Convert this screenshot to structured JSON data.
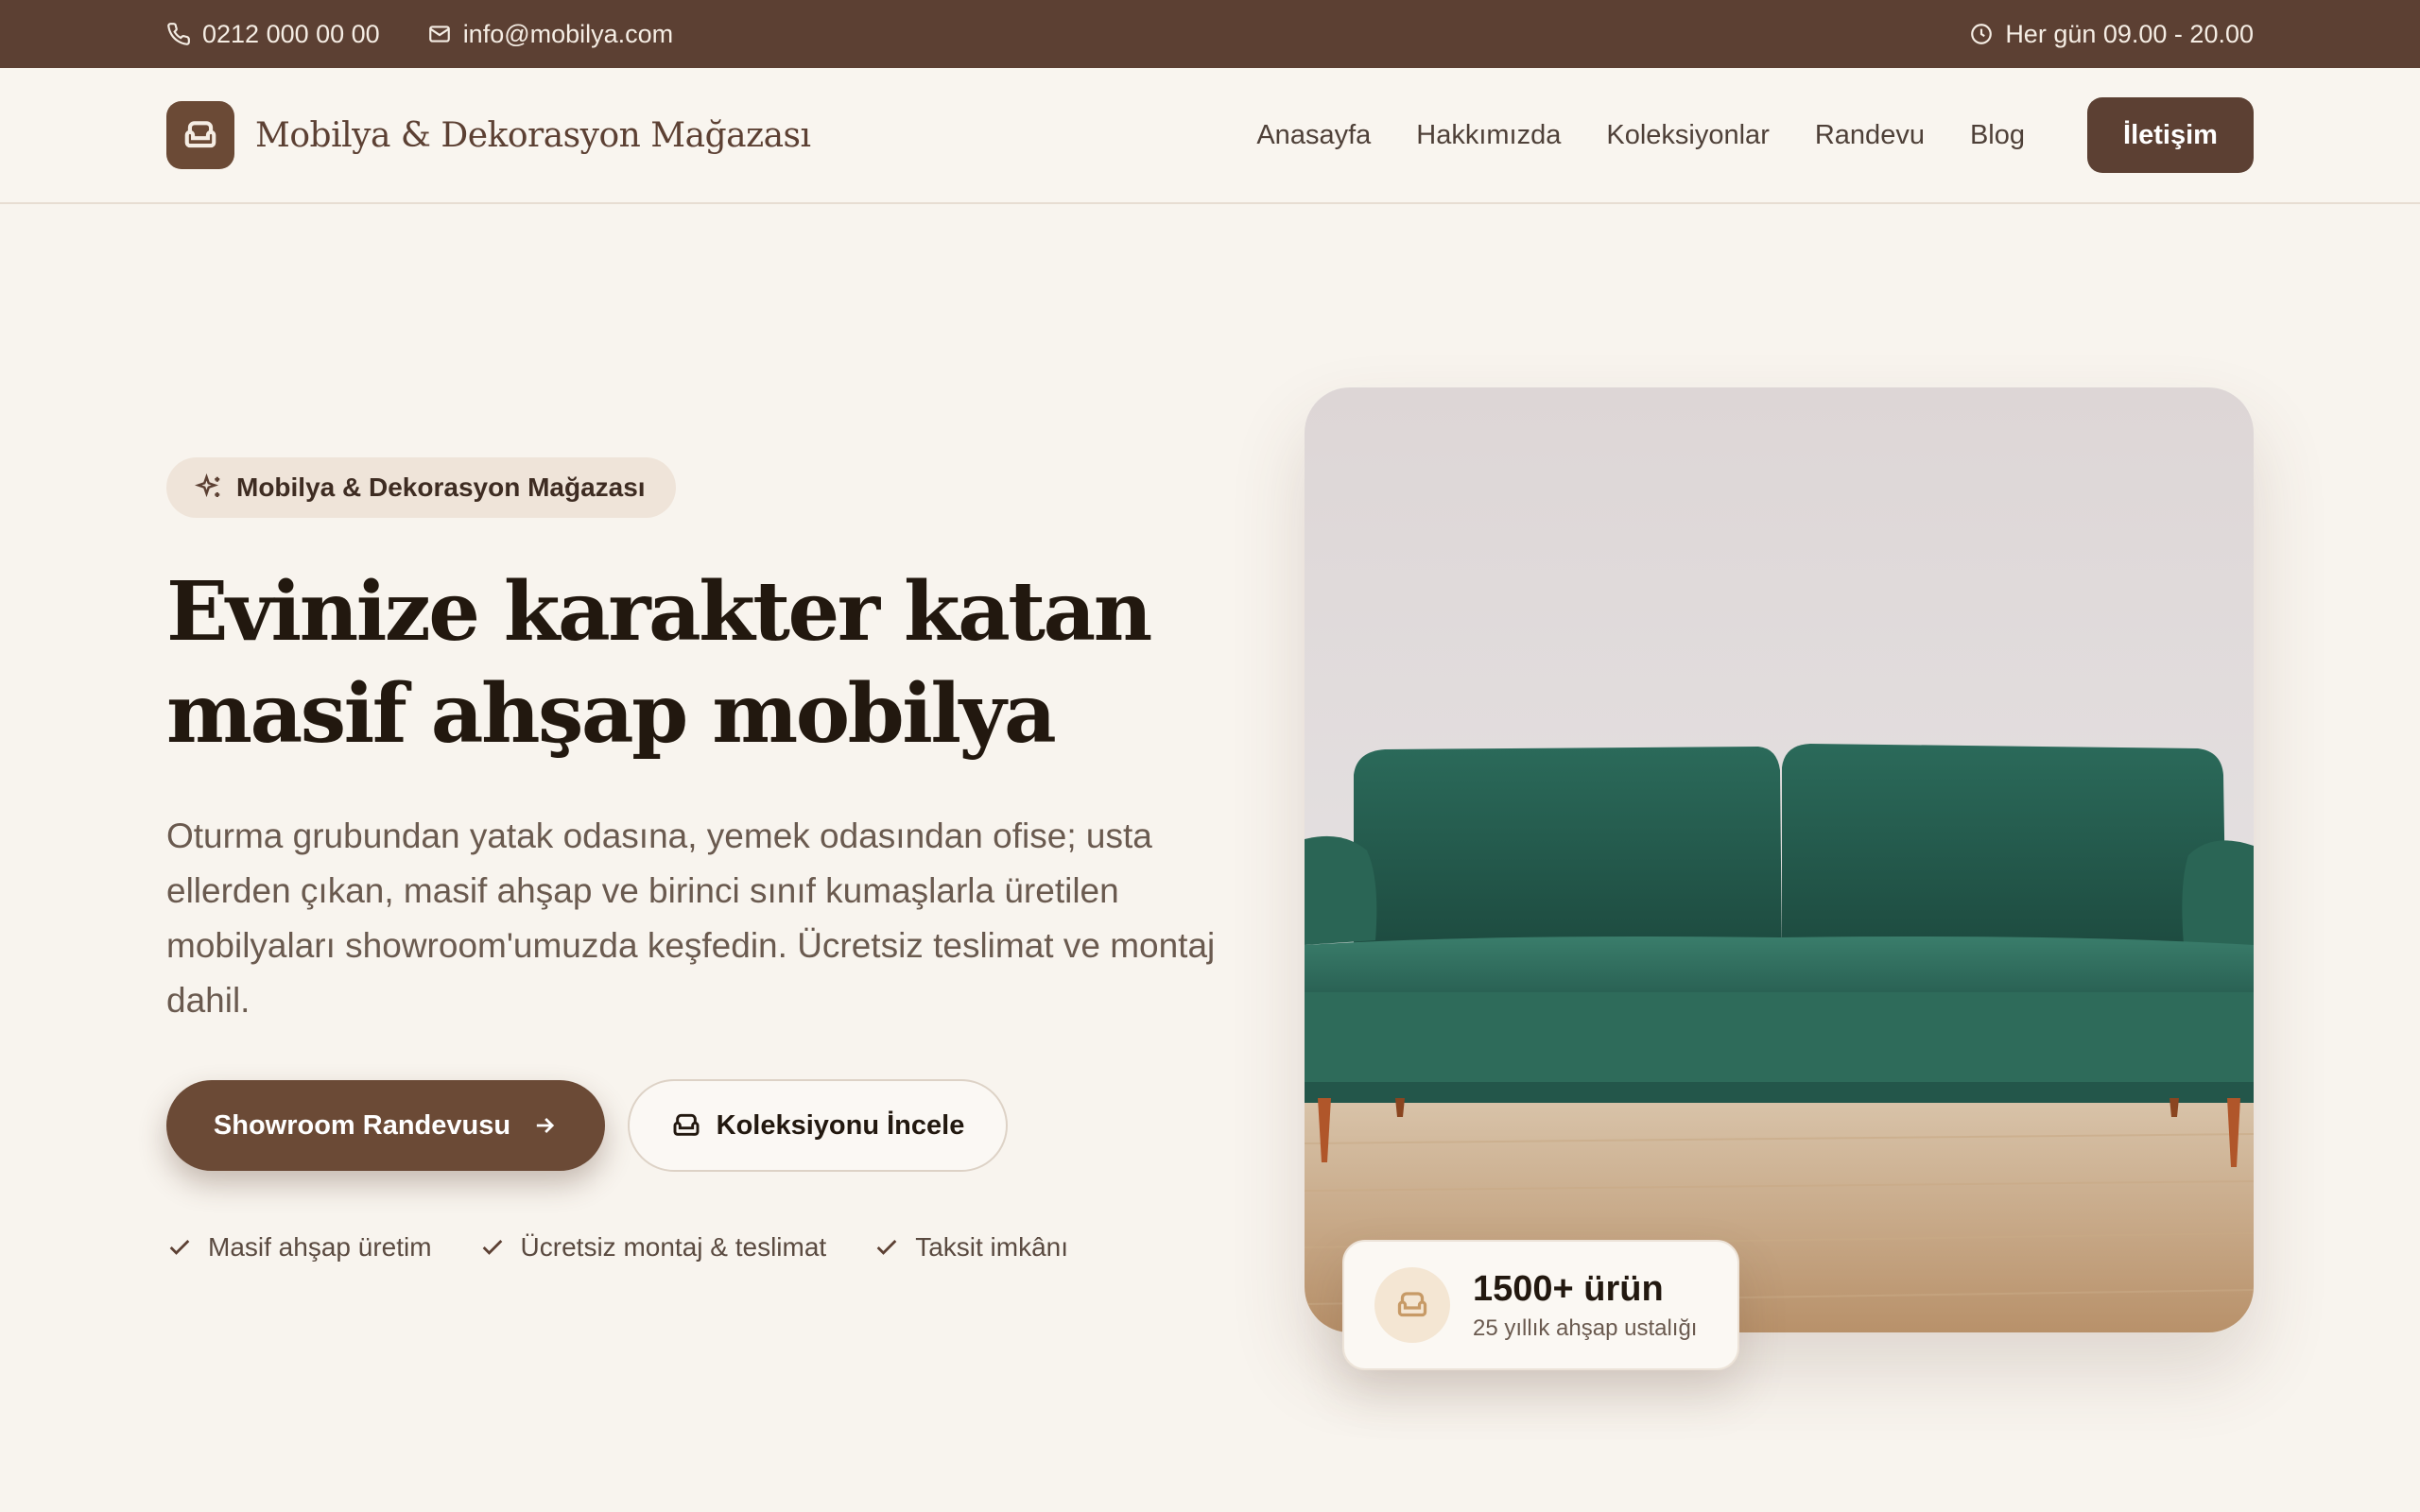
{
  "topbar": {
    "phone": "0212 000 00 00",
    "email": "info@mobilya.com",
    "hours": "Her gün 09.00 - 20.00"
  },
  "header": {
    "brand_name": "Mobilya & Dekorasyon Mağazası",
    "nav": [
      "Anasayfa",
      "Hakkımızda",
      "Koleksiyonlar",
      "Randevu",
      "Blog"
    ],
    "cta": "İletişim"
  },
  "hero": {
    "badge": "Mobilya & Dekorasyon Mağazası",
    "title": "Evinize karakter katan masif ahşap mobilya",
    "description": "Oturma grubundan yatak odasına, yemek odasından ofise; usta ellerden çıkan, masif ahşap ve birinci sınıf kumaşlarla üretilen mobilyaları showroom'umuzda keşfedin. Ücretsiz teslimat ve montaj dahil.",
    "primary_button": "Showroom Randevusu",
    "secondary_button": "Koleksiyonu İncele",
    "features": [
      "Masif ahşap üretim",
      "Ücretsiz montaj & teslimat",
      "Taksit imkânı"
    ]
  },
  "stat": {
    "value": "1500+ ürün",
    "label": "25 yıllık ahşap ustalığı"
  },
  "colors": {
    "brand": "#5c4033",
    "background": "#f8f4ee",
    "sofa": "#2f6b5a"
  },
  "icons": [
    "phone-icon",
    "mail-icon",
    "clock-icon",
    "sofa-icon",
    "sparkles-icon",
    "arrow-right-icon",
    "check-icon"
  ]
}
